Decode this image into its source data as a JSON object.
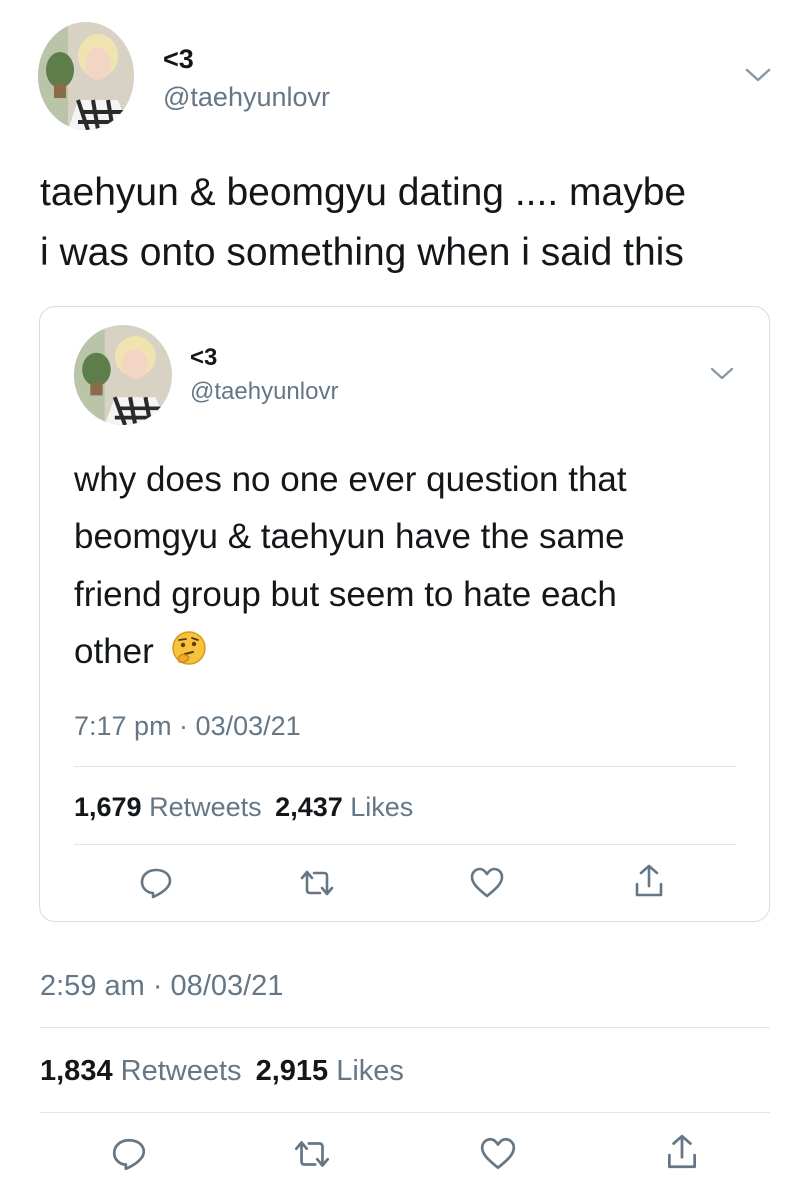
{
  "main_tweet": {
    "display_name": "<3",
    "handle": "@taehyunlovr",
    "text_line1": "taehyun & beomgyu dating .... maybe",
    "text_line2": "i was onto something when i said this",
    "timestamp": "2:59 am · 08/03/21",
    "retweet_count": "1,834",
    "retweet_label": "Retweets",
    "like_count": "2,915",
    "like_label": "Likes"
  },
  "quoted_tweet": {
    "display_name": "<3",
    "handle": "@taehyunlovr",
    "text_line1": "why does no one ever question that",
    "text_line2": "beomgyu & taehyun have the same",
    "text_line3": "friend group but seem to hate each",
    "text_line4": "other",
    "emoji": "thinking-face",
    "timestamp": "7:17 pm · 03/03/21",
    "retweet_count": "1,679",
    "retweet_label": "Retweets",
    "like_count": "2,437",
    "like_label": "Likes"
  },
  "icons": [
    "chevron-down-icon",
    "reply-icon",
    "retweet-icon",
    "like-icon",
    "share-icon"
  ],
  "colors": {
    "text": "#14171a",
    "secondary": "#657786",
    "divider": "#e1e8ed",
    "icon": "#657786"
  }
}
